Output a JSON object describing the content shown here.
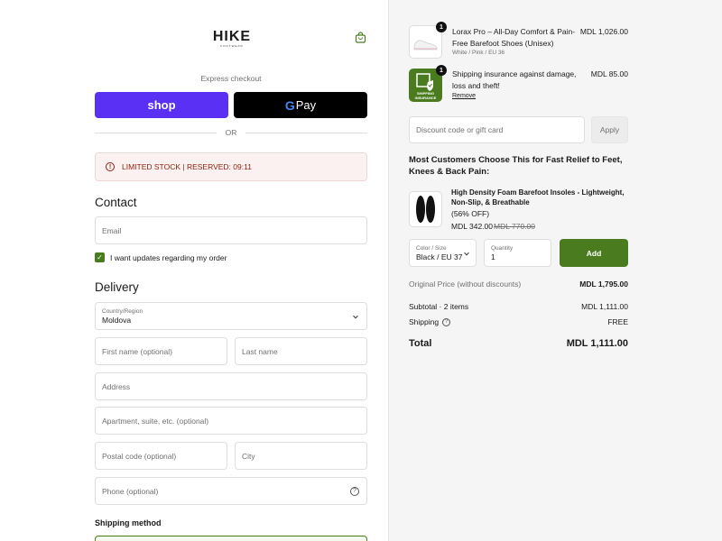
{
  "brand": {
    "name": "HIKE",
    "tagline": "FOOTWEAR"
  },
  "express": {
    "label": "Express checkout",
    "shop_label": "shop",
    "gpay_label": "Pay",
    "or_label": "OR"
  },
  "stock_notice": {
    "text": "LIMITED STOCK | RESERVED: 09:11"
  },
  "contact": {
    "heading": "Contact",
    "email_placeholder": "Email",
    "updates_label": "I want updates regarding my order",
    "updates_checked": true
  },
  "delivery": {
    "heading": "Delivery",
    "country_label": "Country/Region",
    "country_value": "Moldova",
    "first_name_placeholder": "First name (optional)",
    "last_name_placeholder": "Last name",
    "address_placeholder": "Address",
    "apartment_placeholder": "Apartment, suite, etc. (optional)",
    "postal_placeholder": "Postal code (optional)",
    "city_placeholder": "City",
    "phone_placeholder": "Phone (optional)"
  },
  "shipping_method": {
    "heading": "Shipping method"
  },
  "order": {
    "items": [
      {
        "qty": "1",
        "title": "Lorax Pro – All-Day Comfort & Pain-Free Barefoot Shoes (Unisex)",
        "variant": "White / Pink / EU 36",
        "price": "MDL 1,026.00"
      },
      {
        "qty": "1",
        "title": "Shipping insurance against damage, loss and theft!",
        "action": "Remove",
        "price": "MDL 85.00",
        "badge_text": "SHIPPING INSURANCE"
      }
    ],
    "discount_placeholder": "Discount code or gift card",
    "apply_label": "Apply"
  },
  "upsell": {
    "heading": "Most Customers Choose This for Fast Relief to Feet, Knees & Back Pain:",
    "title": "High Density Foam Barefoot Insoles - Lightweight, Non-Slip, & Breathable",
    "discount": "(56% OFF)",
    "price": "MDL 342.00",
    "old_price": "MDL 770.00",
    "color_label": "Color / Size",
    "color_value": "Black / EU 37",
    "qty_label": "Quantity",
    "qty_value": "1",
    "add_label": "Add"
  },
  "summary": {
    "original_label": "Original Price (without discounts)",
    "original_value": "MDL 1,795.00",
    "subtotal_label": "Subtotal · 2 items",
    "subtotal_value": "MDL 1,111.00",
    "shipping_label": "Shipping",
    "shipping_value": "FREE",
    "total_label": "Total",
    "total_value": "MDL 1,111.00"
  },
  "colors": {
    "shop_purple": "#5a31f4",
    "accent_green": "#4a7c1f",
    "alert_red": "#8e1f0b"
  }
}
